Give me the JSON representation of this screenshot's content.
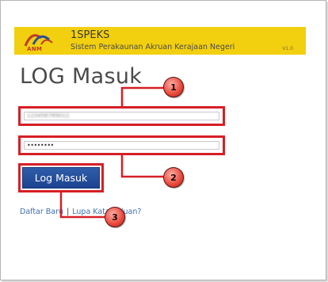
{
  "header": {
    "logo_text": "ANM",
    "app_title": "1SPEKS",
    "app_subtitle": "Sistem Perakaunan Akruan Kerajaan Negeri",
    "version": "V1.0",
    "background": "#f2cf0f"
  },
  "page": {
    "title": "LOG Masuk"
  },
  "form": {
    "username_value": "123456789012",
    "password_value": "••••••••",
    "login_label": "Log Masuk",
    "highlight_color": "#d61f26",
    "button_color": "#1c4390"
  },
  "links": {
    "register": "Daftar Baru",
    "separator": "|",
    "forgot": "Lupa Kata Laluan?"
  },
  "callouts": {
    "one": "1",
    "two": "2",
    "three": "3"
  }
}
